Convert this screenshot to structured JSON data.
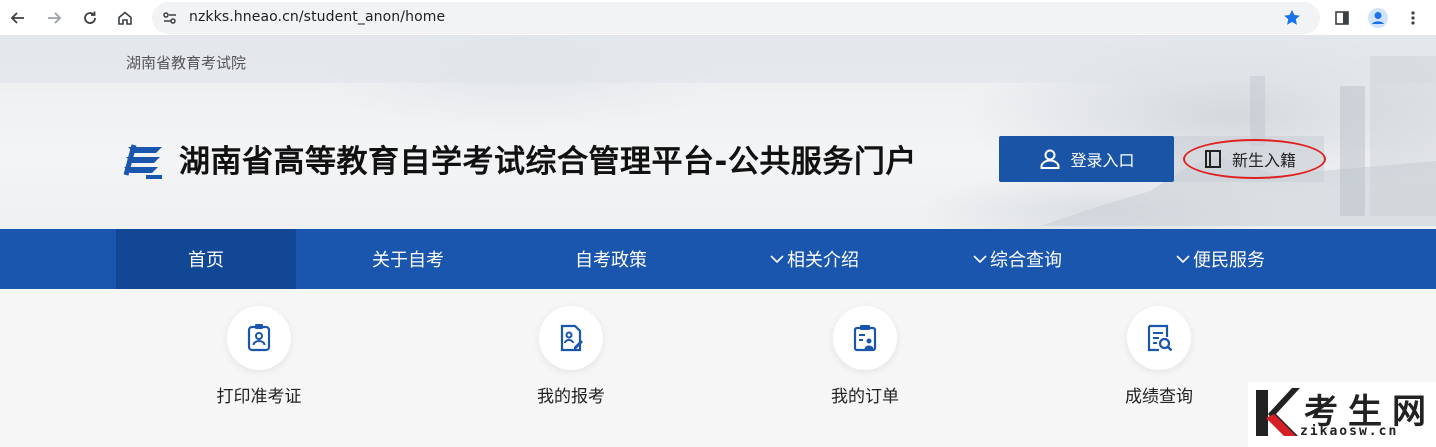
{
  "browser": {
    "url": "nzkks.hneao.cn/student_anon/home",
    "accent_color": "#1a73e8"
  },
  "header": {
    "org_name": "湖南省教育考试院",
    "site_title": "湖南省高等教育自学考试综合管理平台-公共服务门户",
    "login_label": "登录入口",
    "enroll_label": "新生入籍",
    "brand_color": "#1a56ad"
  },
  "nav": {
    "items": [
      {
        "label": "首页",
        "active": true
      },
      {
        "label": "关于自考"
      },
      {
        "label": "自考政策"
      },
      {
        "label": "相关介绍",
        "icon": "chevron-down-icon"
      },
      {
        "label": "综合查询",
        "icon": "chevron-down-icon"
      },
      {
        "label": "便民服务",
        "icon": "chevron-down-icon"
      }
    ]
  },
  "services": [
    {
      "label": "打印准考证",
      "icon": "id-badge-icon"
    },
    {
      "label": "我的报考",
      "icon": "edit-document-icon"
    },
    {
      "label": "我的订单",
      "icon": "clipboard-user-icon"
    },
    {
      "label": "成绩查询",
      "icon": "search-document-icon"
    }
  ],
  "watermark": {
    "text": "考生网",
    "url": "zikaosw.cn",
    "accent": "#d61f26"
  }
}
